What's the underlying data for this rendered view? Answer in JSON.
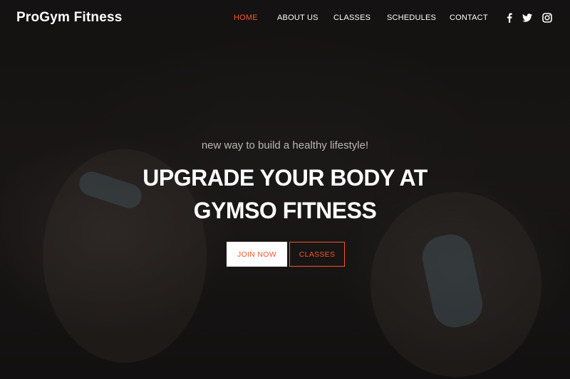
{
  "brand": {
    "name": "ProGym Fitness"
  },
  "nav": {
    "items": [
      {
        "label": "HOME",
        "active": true
      },
      {
        "label": "ABOUT US",
        "active": false
      },
      {
        "label": "CLASSES",
        "active": false
      },
      {
        "label": "SCHEDULES",
        "active": false
      },
      {
        "label": "CONTACT",
        "active": false
      }
    ],
    "social": [
      "facebook-icon",
      "twitter-icon",
      "instagram-icon"
    ]
  },
  "hero": {
    "tagline": "new way to build a healthy lifestyle!",
    "headline_line1": "UPGRADE YOUR BODY AT",
    "headline_line2": "GYMSO FITNESS",
    "primary_button": "JOIN NOW",
    "secondary_button": "CLASSES"
  },
  "colors": {
    "accent": "#f2552c",
    "text": "#ffffff",
    "background": "#161414"
  }
}
